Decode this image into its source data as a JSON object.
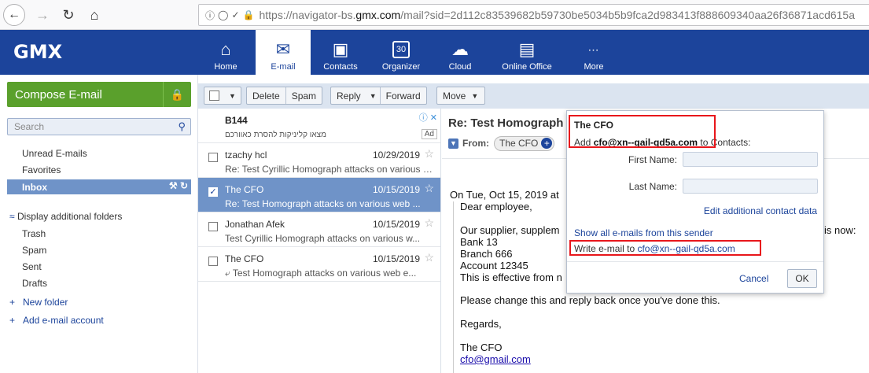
{
  "browser": {
    "url_prefix": "https://navigator-bs.",
    "url_host": "gmx.com",
    "url_rest": "/mail?sid=2d112c83539682b59730be5034b5b9fca2d983413f888609340aa26f36871acd615a"
  },
  "gmx": {
    "logo": "GMX",
    "tabs": [
      {
        "label": "Home",
        "icon": "home-icon"
      },
      {
        "label": "E-mail",
        "icon": "envelope-icon"
      },
      {
        "label": "Contacts",
        "icon": "contacts-icon"
      },
      {
        "label": "Organizer",
        "icon": "calendar-icon",
        "day": "30"
      },
      {
        "label": "Cloud",
        "icon": "cloud-icon"
      },
      {
        "label": "Online Office",
        "icon": "office-icon"
      },
      {
        "label": "More",
        "icon": "grid-icon"
      }
    ]
  },
  "sidebar": {
    "compose": "Compose E-mail",
    "search_placeholder": "Search",
    "unread": "Unread E-mails",
    "favorites": "Favorites",
    "inbox": "Inbox",
    "display_folders": "Display additional folders",
    "folders": [
      "Trash",
      "Spam",
      "Sent",
      "Drafts"
    ],
    "new_folder": "New folder",
    "add_account": "Add e-mail account"
  },
  "toolbar": {
    "delete": "Delete",
    "spam": "Spam",
    "reply": "Reply",
    "forward": "Forward",
    "move": "Move"
  },
  "ad": {
    "title": "B144",
    "subtitle": "מצאו קליניקות להסרת כאוורכם",
    "badge": "Ad"
  },
  "messages": [
    {
      "from": "tzachy hcl",
      "date": "10/29/2019",
      "subject": "Re: Test Cyrillic Homograph attacks on various web ..."
    },
    {
      "from": "The CFO",
      "date": "10/15/2019",
      "subject": "Re: Test Homograph attacks on various web ...",
      "selected": true
    },
    {
      "from": "Jonathan Afek",
      "date": "10/15/2019",
      "subject": "Test Cyrillic Homograph attacks on various w..."
    },
    {
      "from": "The CFO",
      "date": "10/15/2019",
      "subject": "Test Homograph attacks on various web e..."
    }
  ],
  "reader": {
    "subject": "Re: Test Homograph attacks on various web",
    "from_label": "From:",
    "from_name": "The CFO",
    "intro": "On Tue, Oct 15, 2019 at",
    "body": [
      "Dear employee,",
      "Our supplier, supplem",
      "Bank 13",
      "Branch 666",
      "Account 12345",
      "This is effective from n",
      "Please change this and reply back once you've done this.",
      "Regards,",
      "The CFO"
    ],
    "body_tail": "is now:",
    "sig_email": "cfo@gmail.com"
  },
  "popup": {
    "name": "The CFO",
    "add_prefix": "Add ",
    "add_email": "cfo@xn--gail-qd5a.com",
    "add_suffix": " to Contacts:",
    "first_name_label": "First Name:",
    "last_name_label": "Last Name:",
    "edit_more": "Edit additional contact data",
    "show_all": "Show all e-mails from this sender",
    "write_prefix": "Write e-mail to ",
    "write_email": "cfo@xn--gail-qd5a.com",
    "cancel": "Cancel",
    "ok": "OK"
  },
  "colors": {
    "brand": "#1c449b",
    "compose_green": "#5aa02c",
    "selection": "#6f93c8",
    "highlight_box": "#e8161b"
  }
}
